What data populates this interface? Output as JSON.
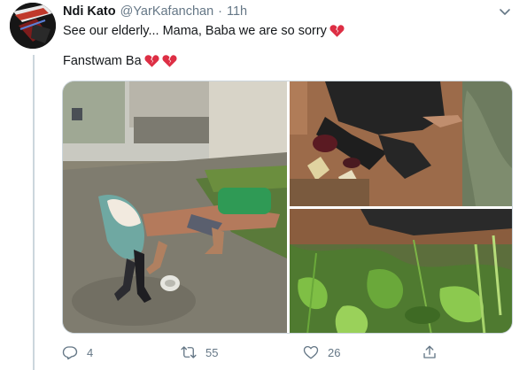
{
  "tweet": {
    "display_name": "Ndi Kato",
    "handle": "@YarKafanchan",
    "separator": "·",
    "time": "11h",
    "text_line_1": "See our elderly... Mama, Baba we are so sorry",
    "text_line_2": "Fanstwam Ba",
    "emoji": "broken-heart-icon"
  },
  "actions": {
    "reply_count": "4",
    "retweet_count": "55",
    "like_count": "26"
  },
  "colors": {
    "text": "#14171a",
    "secondary": "#657786",
    "border": "#ccd6dd",
    "heart_red": "#dd2e44"
  }
}
